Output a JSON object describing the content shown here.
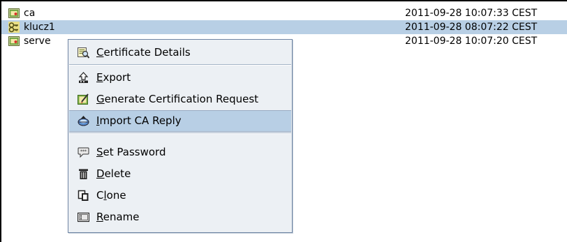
{
  "rows": [
    {
      "name": "ca",
      "date": "2011-09-28 10:07:33 CEST",
      "icon": "certificate-icon"
    },
    {
      "name": "klucz1",
      "date": "2011-09-28 08:07:22 CEST",
      "icon": "keypair-icon"
    },
    {
      "name": "serve",
      "date": "2011-09-28 10:07:20 CEST",
      "icon": "certificate-icon"
    }
  ],
  "menu": [
    {
      "pre": "",
      "u": "C",
      "post": "ertificate Details",
      "icon": "certificate-details-icon"
    },
    {
      "pre": "",
      "u": "E",
      "post": "xport",
      "icon": "export-icon"
    },
    {
      "pre": "",
      "u": "G",
      "post": "enerate Certification Request",
      "icon": "generate-request-icon"
    },
    {
      "pre": "",
      "u": "I",
      "post": "mport CA Reply",
      "icon": "import-ca-reply-icon"
    },
    {
      "pre": "",
      "u": "S",
      "post": "et Password",
      "icon": "set-password-icon"
    },
    {
      "pre": "",
      "u": "D",
      "post": "elete",
      "icon": "delete-icon"
    },
    {
      "pre": "C",
      "u": "l",
      "post": "one",
      "icon": "clone-icon"
    },
    {
      "pre": "",
      "u": "R",
      "post": "ename",
      "icon": "rename-icon"
    }
  ],
  "colors": {
    "selection": "#b8cfe5",
    "menu_bg": "#ecf0f4",
    "menu_border": "#6e84a3"
  }
}
